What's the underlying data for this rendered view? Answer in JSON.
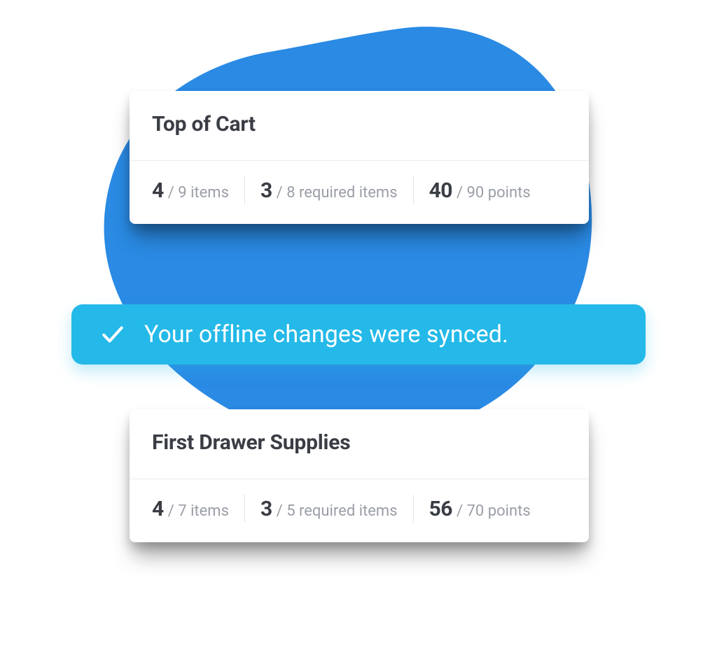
{
  "cards": [
    {
      "title": "Top of Cart",
      "stats": {
        "items": {
          "value": "4",
          "rest": "/ 9 items"
        },
        "required": {
          "value": "3",
          "rest": "/ 8 required items"
        },
        "points": {
          "value": "40",
          "rest": "/ 90 points"
        }
      }
    },
    {
      "title": "First Drawer Supplies",
      "stats": {
        "items": {
          "value": "4",
          "rest": "/ 7 items"
        },
        "required": {
          "value": "3",
          "rest": "/ 5 required items"
        },
        "points": {
          "value": "56",
          "rest": "/ 70 points"
        }
      }
    }
  ],
  "toast": {
    "message": "Your offline changes were synced."
  },
  "colors": {
    "blob": "#2a8ae4",
    "toast": "#24b9e8",
    "textPrimary": "#3a3d44",
    "textMuted": "#9a9ea6"
  }
}
